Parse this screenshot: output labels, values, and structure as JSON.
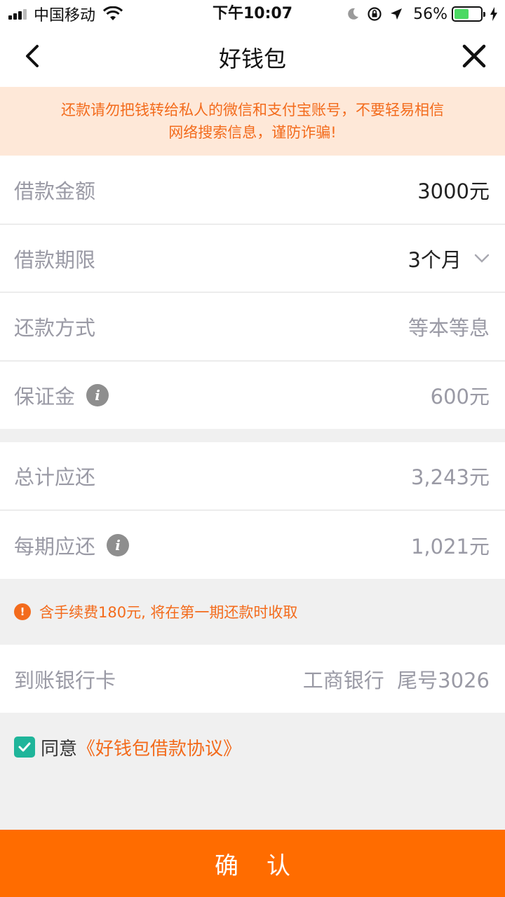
{
  "status_bar": {
    "carrier": "中国移动",
    "time": "下午10:07",
    "battery": "56%",
    "battery_level": 0.56
  },
  "nav": {
    "title": "好钱包",
    "back_icon": "chevron-left-icon",
    "close_icon": "close-icon"
  },
  "notice": {
    "line1": "还款请勿把钱转给私人的微信和支付宝账号，不要轻易相信",
    "line2": "网络搜索信息，谨防诈骗!"
  },
  "loan": {
    "amount_label": "借款金额",
    "amount_value": "3000元",
    "term_label": "借款期限",
    "term_value": "3个月",
    "method_label": "还款方式",
    "method_value": "等本等息",
    "deposit_label": "保证金",
    "deposit_value": "600元"
  },
  "repayment": {
    "total_label": "总计应还",
    "total_value": "3,243元",
    "per_period_label": "每期应还",
    "per_period_value": "1,021元"
  },
  "fee_note": {
    "icon": "!",
    "text": "含手续费180元, 将在第一期还款时收取"
  },
  "bank": {
    "label": "到账银行卡",
    "value": "工商银行  尾号3026"
  },
  "agreement": {
    "prefix": "同意",
    "link": "《好钱包借款协议》",
    "checked": true
  },
  "confirm_label": "确认",
  "colors": {
    "accent": "#ff6c00",
    "notice_bg": "#fee8d8",
    "notice_text": "#f36b1c",
    "checkbox": "#1fb59a"
  }
}
